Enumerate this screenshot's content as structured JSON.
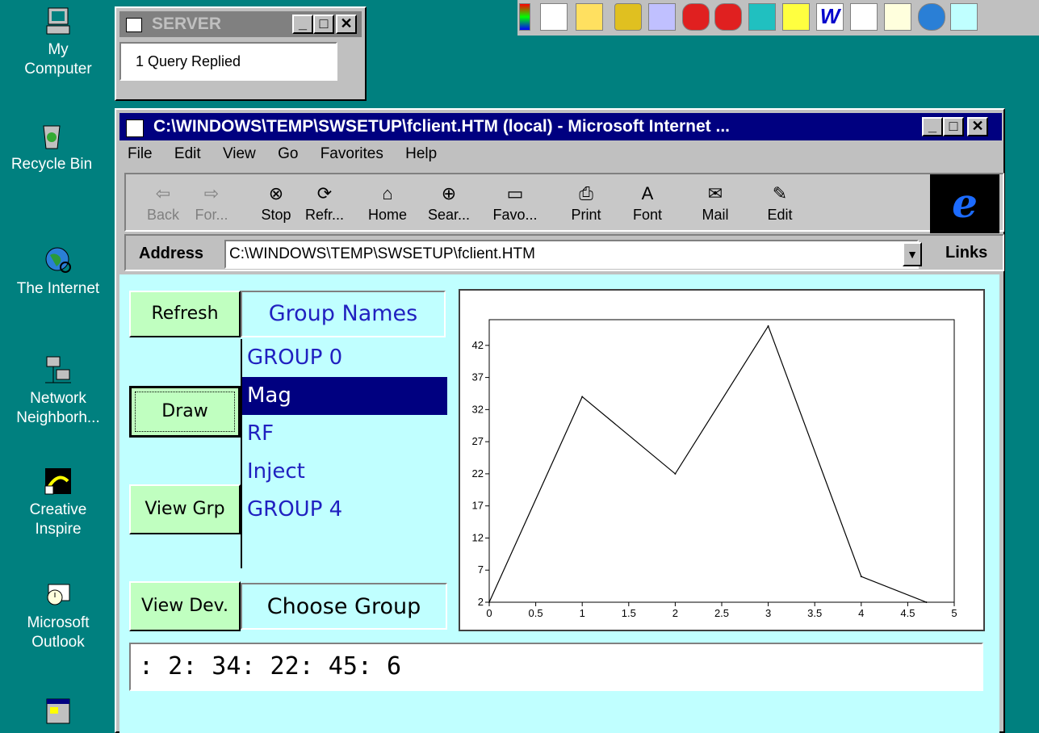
{
  "desktop": {
    "icons": [
      {
        "id": "my-computer",
        "label": "My Computer",
        "label_lines": [
          "My",
          "Computer"
        ]
      },
      {
        "id": "recycle-bin",
        "label": "Recycle Bin"
      },
      {
        "id": "the-internet",
        "label": "The Internet"
      },
      {
        "id": "network-neighborhood",
        "label": "Network Neighborh...",
        "label_lines": [
          "Network",
          "Neighborh..."
        ]
      },
      {
        "id": "creative-inspire",
        "label": "Creative Inspire",
        "label_lines": [
          "Creative",
          "Inspire"
        ]
      },
      {
        "id": "microsoft-outlook",
        "label": "Microsoft Outlook",
        "label_lines": [
          "Microsoft",
          "Outlook"
        ]
      },
      {
        "id": "setup-shortcut",
        "label": ""
      }
    ]
  },
  "server_window": {
    "title": "SERVER",
    "message": "1 Query Replied"
  },
  "ie_window": {
    "title": "C:\\WINDOWS\\TEMP\\SWSETUP\\fclient.HTM (local) - Microsoft Internet ...",
    "menu": [
      "File",
      "Edit",
      "View",
      "Go",
      "Favorites",
      "Help"
    ],
    "toolbar": [
      {
        "id": "back",
        "label": "Back",
        "icon": "back-arrow-icon",
        "glyph": "⇦",
        "disabled": true
      },
      {
        "id": "forward",
        "label": "For...",
        "icon": "forward-arrow-icon",
        "glyph": "⇨",
        "disabled": true
      },
      {
        "id": "stop",
        "label": "Stop",
        "icon": "stop-icon",
        "glyph": "⊗",
        "disabled": false
      },
      {
        "id": "refresh",
        "label": "Refr...",
        "icon": "refresh-icon",
        "glyph": "⟳",
        "disabled": false
      },
      {
        "id": "home",
        "label": "Home",
        "icon": "home-icon",
        "glyph": "⌂",
        "disabled": false
      },
      {
        "id": "search",
        "label": "Sear...",
        "icon": "search-icon",
        "glyph": "⊕",
        "disabled": false
      },
      {
        "id": "favorites",
        "label": "Favo...",
        "icon": "favorites-folder-icon",
        "glyph": "▭",
        "disabled": false
      },
      {
        "id": "print",
        "label": "Print",
        "icon": "printer-icon",
        "glyph": "⎙",
        "disabled": false
      },
      {
        "id": "font",
        "label": "Font",
        "icon": "font-icon",
        "glyph": "A",
        "disabled": false
      },
      {
        "id": "mail",
        "label": "Mail",
        "icon": "mail-icon",
        "glyph": "✉",
        "disabled": false
      },
      {
        "id": "edit",
        "label": "Edit",
        "icon": "edit-icon",
        "glyph": "✎",
        "disabled": false
      }
    ],
    "address_label": "Address",
    "address_value": "C:\\WINDOWS\\TEMP\\SWSETUP\\fclient.HTM",
    "links_label": "Links"
  },
  "app": {
    "buttons": {
      "refresh": "Refresh",
      "draw": "Draw",
      "view_grp": "View Grp",
      "view_dev": "View Dev."
    },
    "group_header": "Group Names",
    "groups": [
      "GROUP 0",
      "Mag",
      "RF",
      "Inject",
      "GROUP 4"
    ],
    "selected_group": "Mag",
    "choose_group": "Choose Group",
    "output_text": ": 2: 34: 22: 45: 6"
  },
  "colors": {
    "desktop": "#00807f",
    "titlebar_active": "#000080",
    "content_bg": "#c0ffff",
    "button_bg": "#c0ffc0",
    "group_text": "#2020c0"
  },
  "chart_data": {
    "type": "line",
    "x": [
      0,
      1,
      2,
      3,
      4,
      4.7
    ],
    "y": [
      2,
      34,
      22,
      45,
      6,
      2
    ],
    "xlim": [
      0,
      5
    ],
    "ylim": [
      2,
      46
    ],
    "x_ticks": [
      0,
      0.5,
      1,
      1.5,
      2,
      2.5,
      3,
      3.5,
      4,
      4.5,
      5
    ],
    "y_ticks": [
      2,
      7,
      12,
      17,
      22,
      27,
      32,
      37,
      42
    ],
    "grid": false
  }
}
